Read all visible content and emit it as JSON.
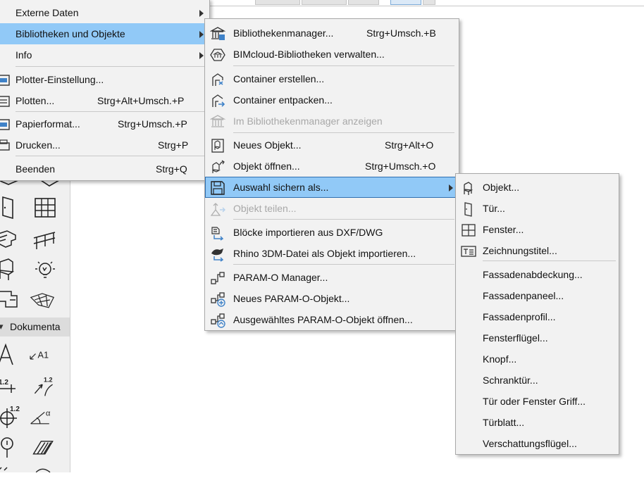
{
  "main_menu": {
    "items": [
      {
        "label": "Externe Daten",
        "arrow": true
      },
      {
        "label": "Bibliotheken und Objekte",
        "arrow": true
      },
      {
        "label": "Info",
        "arrow": true
      },
      {
        "label": "Plotter-Einstellung..."
      },
      {
        "label": "Plotten...",
        "shortcut": "Strg+Alt+Umsch.+P"
      },
      {
        "label": "Papierformat...",
        "shortcut": "Strg+Umsch.+P"
      },
      {
        "label": "Drucken...",
        "shortcut": "Strg+P"
      },
      {
        "label": "Beenden",
        "shortcut": "Strg+Q"
      }
    ]
  },
  "library_menu": {
    "items": [
      {
        "label": "Bibliothekenmanager...",
        "shortcut": "Strg+Umsch.+B",
        "icon": "library-manager-icon"
      },
      {
        "label": "BIMcloud-Bibliotheken verwalten...",
        "icon": "bimcloud-library-icon"
      },
      {
        "label": "Container erstellen...",
        "icon": "container-create-icon"
      },
      {
        "label": "Container entpacken...",
        "icon": "container-extract-icon"
      },
      {
        "label": "Im Bibliothekenmanager anzeigen",
        "icon": "show-in-library-icon",
        "disabled": true
      },
      {
        "label": "Neues Objekt...",
        "shortcut": "Strg+Alt+O",
        "icon": "new-object-icon"
      },
      {
        "label": "Objekt öffnen...",
        "shortcut": "Strg+Umsch.+O",
        "icon": "open-object-icon"
      },
      {
        "label": "Auswahl sichern als...",
        "icon": "save-selection-icon",
        "arrow": true
      },
      {
        "label": "Objekt teilen...",
        "icon": "share-object-icon",
        "disabled": true
      },
      {
        "label": "Blöcke importieren aus DXF/DWG",
        "icon": "import-dxf-icon"
      },
      {
        "label": "Rhino 3DM-Datei als Objekt importieren...",
        "icon": "import-rhino-icon"
      },
      {
        "label": "PARAM-O Manager...",
        "icon": "param-o-manager-icon"
      },
      {
        "label": "Neues PARAM-O-Objekt...",
        "icon": "new-param-o-icon"
      },
      {
        "label": "Ausgewähltes PARAM-O-Objekt öffnen...",
        "icon": "open-param-o-icon"
      }
    ]
  },
  "save_as_menu": {
    "items": [
      {
        "label": "Objekt...",
        "icon": "object-chair-icon"
      },
      {
        "label": "Tür...",
        "icon": "door-icon"
      },
      {
        "label": "Fenster...",
        "icon": "window-icon"
      },
      {
        "label": "Zeichnungstitel...",
        "icon": "drawing-title-icon"
      },
      {
        "label": "Fassadenabdeckung..."
      },
      {
        "label": "Fassadenpaneel..."
      },
      {
        "label": "Fassadenprofil..."
      },
      {
        "label": "Fensterflügel..."
      },
      {
        "label": "Knopf..."
      },
      {
        "label": "Schranktür..."
      },
      {
        "label": "Tür oder Fenster Griff..."
      },
      {
        "label": "Türblatt..."
      },
      {
        "label": "Verschattungsflügel..."
      }
    ]
  },
  "toolbox": {
    "section_label": "Dokumenta",
    "document_icons": [
      "text-icon",
      "label-icon",
      "dimension-icon",
      "level-dimension-icon",
      "spot-elevation-icon",
      "angle-dimension-icon",
      "marker-icon",
      "fill-icon"
    ]
  },
  "colors": {
    "highlight": "#91c9f7",
    "menu_bg": "#f2f2f2",
    "disabled_text": "#a8a8a8"
  }
}
